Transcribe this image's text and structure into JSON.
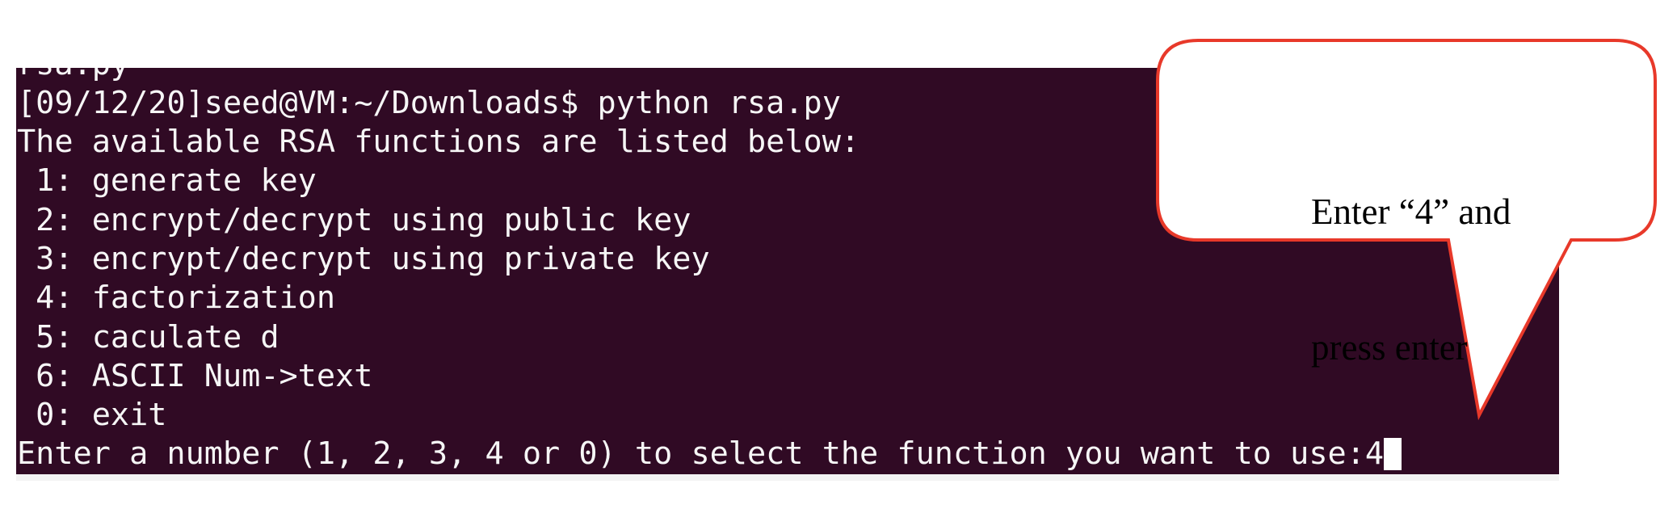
{
  "terminal": {
    "lines": [
      "rsa.py",
      "[09/12/20]seed@VM:~/Downloads$ python rsa.py",
      "The available RSA functions are listed below:",
      " 1: generate key",
      " 2: encrypt/decrypt using public key",
      " 3: encrypt/decrypt using private key",
      " 4: factorization",
      " 5: caculate d",
      " 6: ASCII Num->text",
      " 0: exit"
    ],
    "prompt": "Enter a number (1, 2, 3, 4 or 0) to select the function you want to use:",
    "input_value": "4",
    "background": "#300a24"
  },
  "callout": {
    "line1": "Enter “4” and",
    "line2": "press enter",
    "border_color": "#e8392a"
  }
}
